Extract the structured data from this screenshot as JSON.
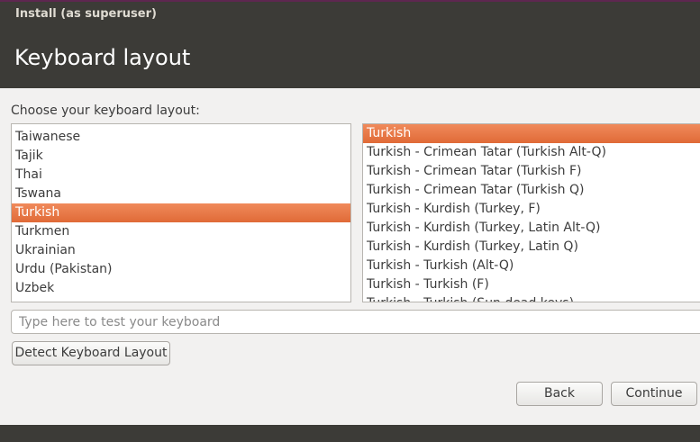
{
  "window": {
    "title": "Install (as superuser)"
  },
  "header": {
    "title": "Keyboard layout"
  },
  "prompt": "Choose your keyboard layout:",
  "layouts": {
    "items": [
      "Taiwanese",
      "Tajik",
      "Thai",
      "Tswana",
      "Turkish",
      "Turkmen",
      "Ukrainian",
      "Urdu (Pakistan)",
      "Uzbek"
    ],
    "selected": "Turkish"
  },
  "variants": {
    "items": [
      "Turkish",
      "Turkish - Crimean Tatar (Turkish Alt-Q)",
      "Turkish - Crimean Tatar (Turkish F)",
      "Turkish - Crimean Tatar (Turkish Q)",
      "Turkish - Kurdish (Turkey, F)",
      "Turkish - Kurdish (Turkey, Latin Alt-Q)",
      "Turkish - Kurdish (Turkey, Latin Q)",
      "Turkish - Turkish (Alt-Q)",
      "Turkish - Turkish (F)",
      "Turkish - Turkish (Sun dead keys)"
    ],
    "selected": "Turkish"
  },
  "test_input": {
    "placeholder": "Type here to test your keyboard",
    "value": ""
  },
  "buttons": {
    "detect": "Detect Keyboard Layout",
    "back": "Back",
    "continue": "Continue"
  },
  "colors": {
    "selection": "#e9743f",
    "chrome": "#3c3b37"
  }
}
